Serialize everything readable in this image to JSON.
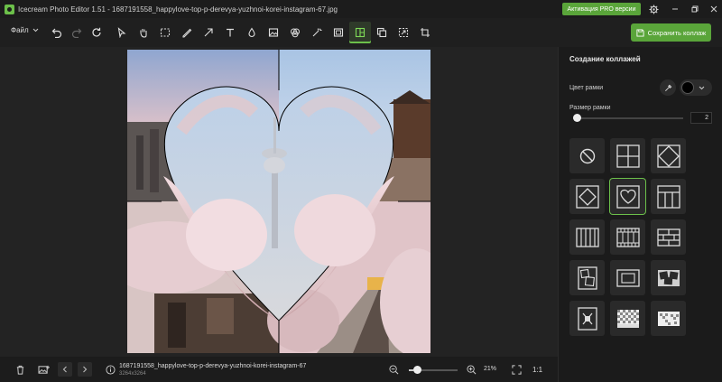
{
  "titlebar": {
    "title": "Icecream Photo Editor 1.51 - 1687191558_happylove-top-p-derevya-yuzhnoi-korei-instagram-67.jpg",
    "pro_label": "Активация PRO версии"
  },
  "toolbar": {
    "file_label": "Файл",
    "save_label": "Сохранить коллаж",
    "tools": [
      "undo-icon",
      "redo-icon",
      "reset-icon",
      "select-icon",
      "hand-icon",
      "crop-select-icon",
      "brush-icon",
      "arrow-icon",
      "text-icon",
      "drop-icon",
      "image-icon",
      "color-icon",
      "magic-icon",
      "frame-icon",
      "collage-icon",
      "layers-icon",
      "resize-icon",
      "crop-icon"
    ],
    "active_tool": "collage-icon"
  },
  "panel": {
    "title": "Создание коллажей",
    "frame_color_label": "Цвет рамки",
    "frame_size_label": "Размер рамки",
    "frame_size_value": "2",
    "frame_color": "#000000",
    "templates": [
      "none",
      "grid-2x2",
      "diamond",
      "diamond-frame",
      "heart",
      "columns-t",
      "strip-5",
      "film",
      "bricks",
      "stack-portrait",
      "stack-landscape",
      "scatter",
      "cross",
      "checker",
      "checker-2"
    ],
    "selected_template": "heart"
  },
  "bottombar": {
    "filename": "1687191558_happylove-top-p-derevya-yuzhnoi-korei-instagram-67",
    "dimensions": "3264x3264",
    "zoom": "21%",
    "one_to_one": "1:1",
    "zoom_fraction": 0.21
  },
  "colors": {
    "accent": "#5aa53a",
    "background": "#1f1f1f",
    "panel": "#1b1b1b"
  }
}
